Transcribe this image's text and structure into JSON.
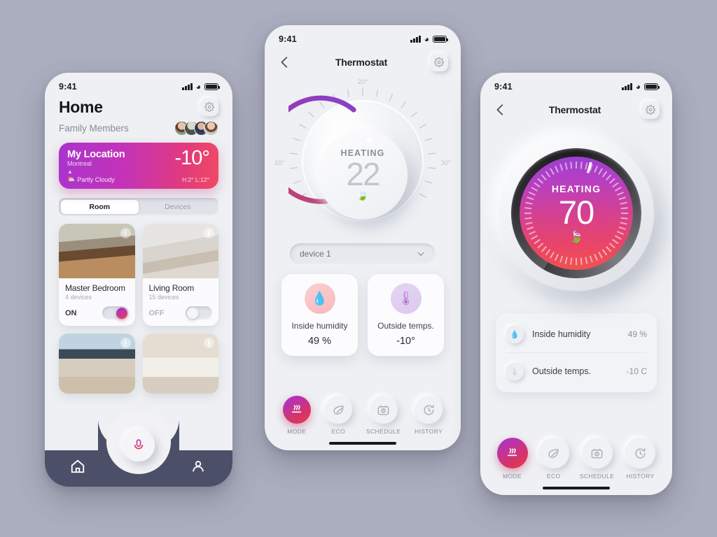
{
  "background_color": "#abaebe",
  "accent_gradient": {
    "from": "#a633d6",
    "to": "#e8404f"
  },
  "status_bar": {
    "time": "9:41"
  },
  "home_screen": {
    "title": "Home",
    "settings_icon": "gear-icon",
    "family_label": "Family Members",
    "weather": {
      "location": "My Location",
      "city": "Montreal",
      "temp": "-10°",
      "condition": "Partly Cloudy",
      "high_low": "H:2°  L:12°",
      "gradient_from": "#a934cd",
      "gradient_to": "#ef4a63"
    },
    "segments": [
      {
        "label": "Room",
        "active": true
      },
      {
        "label": "Devices",
        "active": false
      }
    ],
    "rooms": [
      {
        "name": "Master Bedroom",
        "devices": "4 devices",
        "state": "ON",
        "on": true
      },
      {
        "name": "Living Room",
        "devices": "15 devices",
        "state": "OFF",
        "on": false
      }
    ],
    "nav": [
      {
        "icon": "home-icon"
      },
      {
        "icon": "mic-icon"
      },
      {
        "icon": "person-icon"
      }
    ]
  },
  "dial_screen": {
    "nav_title": "Thermostat",
    "back_icon": "chevron-left-icon",
    "settings_icon": "gear-icon",
    "dial": {
      "label_top": "20°",
      "label_left": "10°",
      "label_right": "30°",
      "status": "HEATING",
      "value": "22",
      "eco_icon": "leaf-icon",
      "arc_from": "#8b3fc4",
      "arc_to": "#c4456e"
    },
    "device_selector": {
      "value": "device 1",
      "chevron": "chevron-down-icon"
    },
    "sensor_cards": [
      {
        "icon": "humidity-icon",
        "name": "Inside humidity",
        "value": "49 %"
      },
      {
        "icon": "thermometer-icon",
        "name": "Outside temps.",
        "value": "-10°"
      }
    ],
    "tabs": [
      {
        "label": "MODE",
        "icon": "heat-waves-icon",
        "active": true
      },
      {
        "label": "ECO",
        "icon": "leaf-outline-icon",
        "active": false
      },
      {
        "label": "SCHEDULE",
        "icon": "camera-clock-icon",
        "active": false
      },
      {
        "label": "HISTORY",
        "icon": "history-icon",
        "active": false
      }
    ]
  },
  "nest_screen": {
    "nav_title": "Thermostat",
    "back_icon": "chevron-left-icon",
    "settings_icon": "gear-icon",
    "dial": {
      "status": "HEATING",
      "value": "70",
      "eco_icon": "leaf-icon",
      "face_from": "#9a3fd0",
      "face_to": "#f2524f"
    },
    "info_rows": [
      {
        "icon": "humidity-icon",
        "name": "Inside humidity",
        "value": "49 %"
      },
      {
        "icon": "thermometer-icon",
        "name": "Outside temps.",
        "value": "-10 C"
      }
    ],
    "tabs": [
      {
        "label": "MODE",
        "icon": "heat-waves-icon",
        "active": true
      },
      {
        "label": "ECO",
        "icon": "leaf-outline-icon",
        "active": false
      },
      {
        "label": "SCHEDULE",
        "icon": "camera-clock-icon",
        "active": false
      },
      {
        "label": "HISTORY",
        "icon": "history-icon",
        "active": false
      }
    ]
  }
}
